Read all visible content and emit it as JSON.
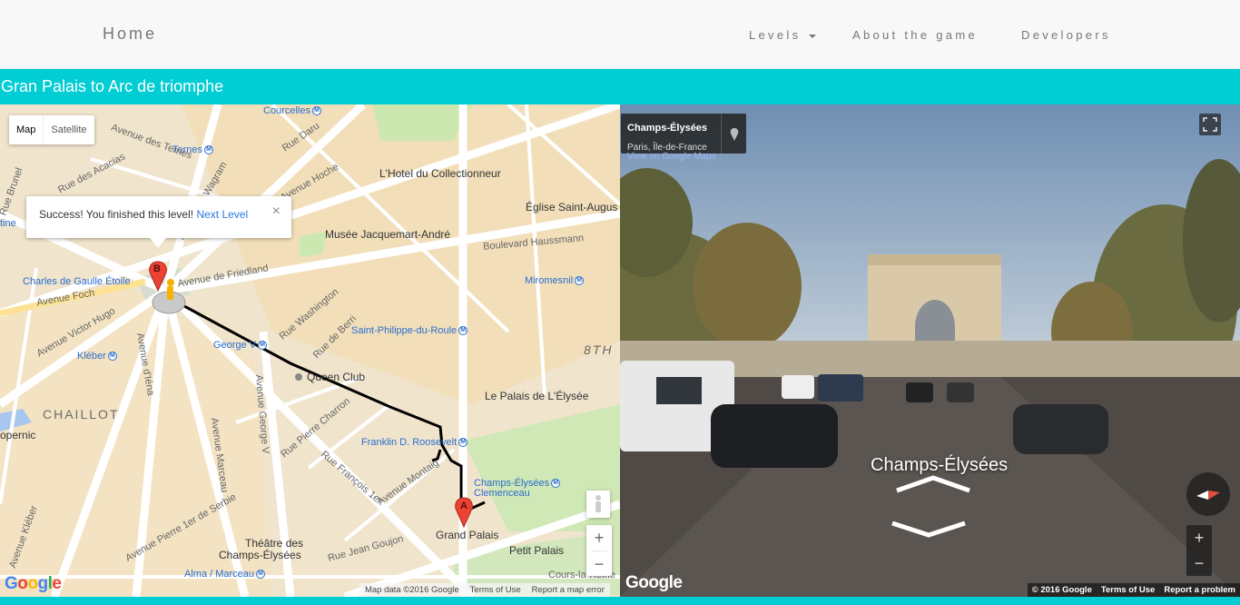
{
  "navbar": {
    "brand": "Home",
    "levels": "Levels",
    "about": "About the game",
    "developers": "Developers"
  },
  "level": {
    "title": "Gran Palais to Arc de triomphe"
  },
  "map": {
    "type_map": "Map",
    "type_satellite": "Satellite",
    "info": {
      "message": "Success! You finished this level!",
      "next": "Next Level",
      "close": "×"
    },
    "marker_a": "A",
    "marker_b": "B",
    "labels": {
      "courcelles": "Courcelles",
      "ternes": "Ternes",
      "rue_daru": "Rue Daru",
      "av_des_ternes": "Avenue des Ternes",
      "av_hoche": "Avenue Hoche",
      "hotel": "L'Hotel du Collectionneur",
      "eglise": "Église Saint-Augus",
      "jacquemart": "Musée Jacquemart-André",
      "haussmann": "Boulevard Haussmann",
      "friedland": "Avenue de Friedland",
      "etoile": "Charles de Gaulle Étoile",
      "miromesnil": "Miromesnil",
      "av_foch": "Avenue Foch",
      "victor_hugo": "Avenue Victor Hugo",
      "washington": "Rue Washington",
      "rue_berri": "Rue de Berri",
      "st_philippe": "Saint-Philippe-du-Roule",
      "george_v": "George V",
      "kleber": "Kléber",
      "queen": "Queen Club",
      "eighth": "8TH",
      "elysee": "Le Palais de L'Élysée",
      "chaillot": "CHAILLOT",
      "charron": "Rue Pierre Charron",
      "iena": "Avenue d'Iéna",
      "marceau": "Avenue Marceau",
      "george_v_av": "Avenue George V",
      "roosevelt": "Franklin D. Roosevelt",
      "francois": "Rue François 1er",
      "montaigne": "Avenue Montaig",
      "clemenceau_1": "Champs-Élysées",
      "clemenceau_2": "Clemenceau",
      "grand_palais": "Grand Palais",
      "petit_palais": "Petit Palais",
      "serbie": "Avenue Pierre 1er de Serbie",
      "goujon": "Rue Jean Goujon",
      "theatre_1": "Théâtre des",
      "theatre_2": "Champs-Élysées",
      "alma": "Alma / Marceau",
      "reine": "Cours-la-Reine",
      "kleber_av": "Avenue Kléber",
      "copernic": "opernic",
      "tine": "tine",
      "brunel": "Rue Brunel",
      "acacias": "Rue des Acacias",
      "av_ternes2": "Avenue de Wagram"
    },
    "attribution": {
      "data": "Map data ©2016 Google",
      "terms": "Terms of Use",
      "report": "Report a map error"
    },
    "zoom_in": "+",
    "zoom_out": "−"
  },
  "streetview": {
    "place": "Champs-Élysées",
    "region": "Paris, Île-de-France",
    "link": "View on Google Maps",
    "street_label": "Champs-Élysées",
    "attribution": {
      "copyright": "© 2016 Google",
      "terms": "Terms of Use",
      "report": "Report a problem"
    },
    "zoom_in": "+",
    "zoom_out": "−"
  },
  "google": "Google",
  "colors": {
    "accent": "#00cdd4",
    "route": "#000000",
    "marker": "#ea4335"
  }
}
